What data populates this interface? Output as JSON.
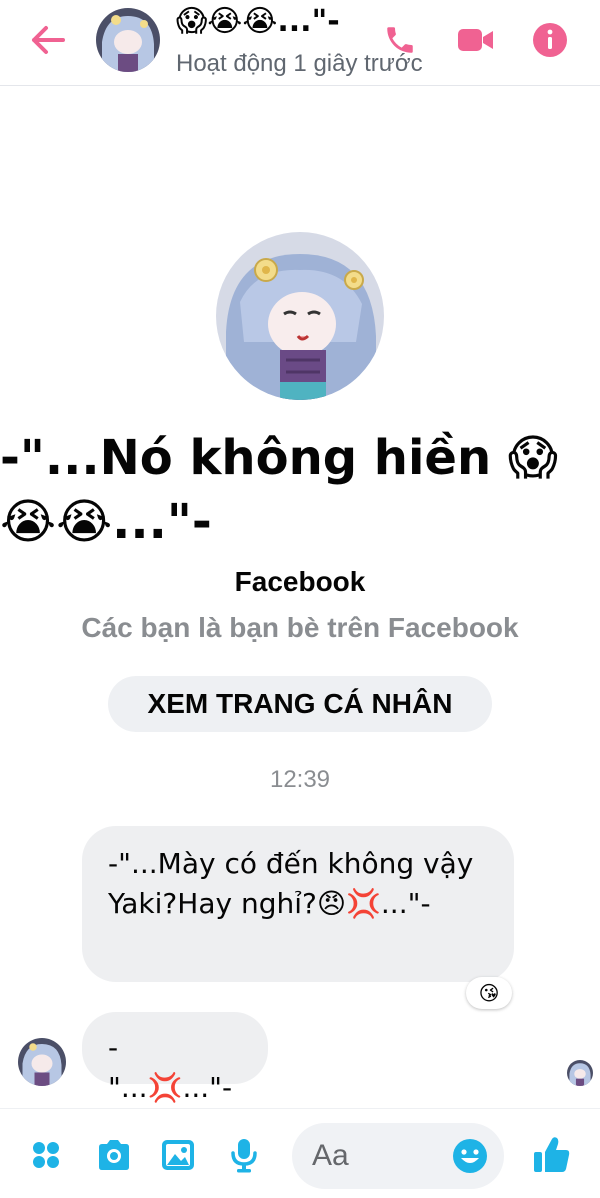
{
  "header": {
    "back_icon": "arrow-left-icon",
    "name": "😱😭😭...\"-",
    "status": "Hoạt động 1 giây trước",
    "call_icon": "phone-icon",
    "video_icon": "video-camera-icon",
    "info_icon": "info-icon",
    "accent_color": "#f06292"
  },
  "profile": {
    "name": "-\"...Nó không hiền 😱😭😭...\"-",
    "platform": "Facebook",
    "friend_note": "Các bạn là bạn bè trên Facebook",
    "view_profile_label": "XEM TRANG CÁ NHÂN"
  },
  "thread": {
    "timestamp": "12:39",
    "messages": [
      {
        "text": "-\"...Mày có đến không vậy Yaki?Hay nghỉ?😠💢...\"-",
        "reaction": "😘"
      },
      {
        "text": "-\"...💢...\"-"
      }
    ]
  },
  "composer": {
    "placeholder": "Aa",
    "menu_icon": "four-dots-icon",
    "camera_icon": "camera-icon",
    "gallery_icon": "image-icon",
    "mic_icon": "microphone-icon",
    "emoji_icon": "smiley-icon",
    "like_icon": "thumbs-up-icon",
    "accent_color": "#1eb3e6"
  }
}
